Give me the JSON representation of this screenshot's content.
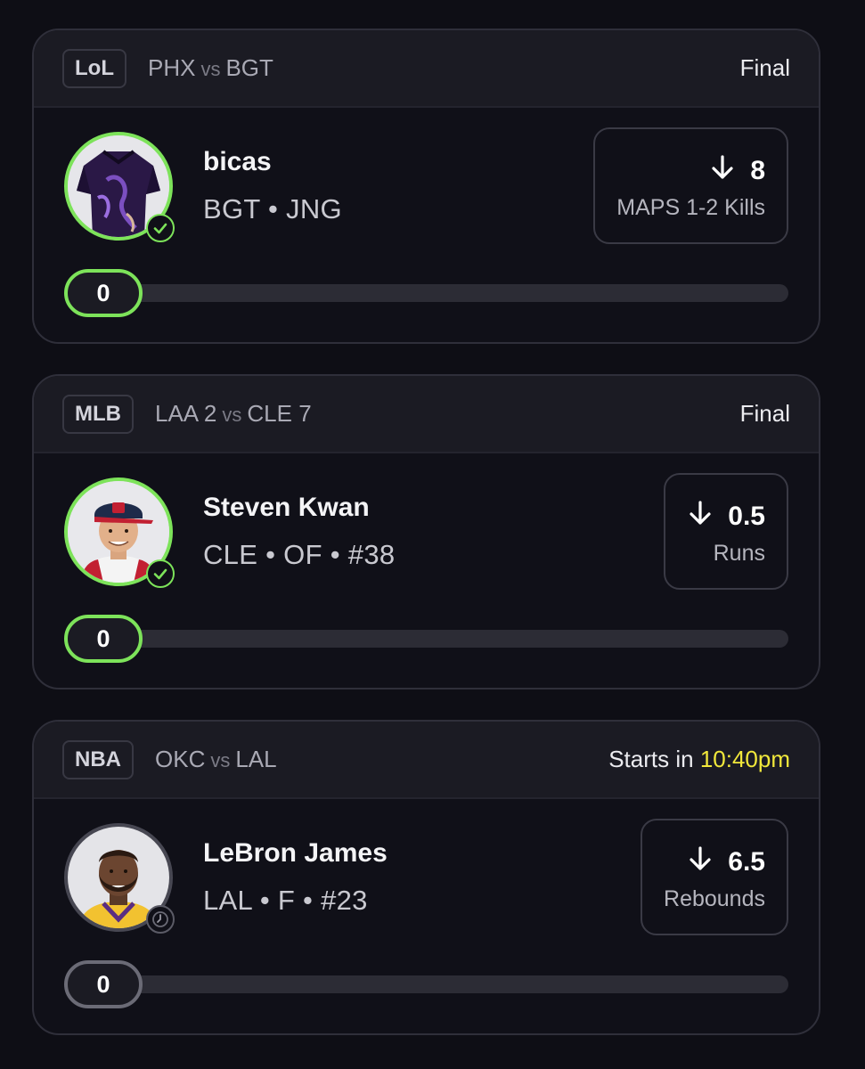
{
  "colors": {
    "accent_green": "#7de35a",
    "time_yellow": "#f1e83b",
    "background": "#0e0e15",
    "card_header": "#1b1b23"
  },
  "cards": [
    {
      "league": "LoL",
      "team1": "PHX",
      "vs": "vs",
      "team2": "BGT",
      "status": "Final",
      "player_name": "bicas",
      "player_info": "BGT • JNG",
      "direction_icon": "arrow-down-icon",
      "line_value": "8",
      "line_stat": "MAPS 1-2 Kills",
      "current_value": "0",
      "avatar": "jersey-avatar",
      "result_icon": "check-circle-icon"
    },
    {
      "league": "MLB",
      "team1": "LAA 2",
      "vs": "vs",
      "team2": "CLE 7",
      "status": "Final",
      "player_name": "Steven Kwan",
      "player_info": "CLE • OF • #38",
      "direction_icon": "arrow-down-icon",
      "line_value": "0.5",
      "line_stat": "Runs",
      "current_value": "0",
      "avatar": "player-headshot",
      "result_icon": "check-circle-icon"
    },
    {
      "league": "NBA",
      "team1": "OKC",
      "vs": "vs",
      "team2": "LAL",
      "status_prefix": "Starts in",
      "status_time": "10:40pm",
      "player_name": "LeBron James",
      "player_info": "LAL • F • #23",
      "direction_icon": "arrow-down-icon",
      "line_value": "6.5",
      "line_stat": "Rebounds",
      "current_value": "0",
      "avatar": "player-headshot",
      "result_icon": "clock-icon"
    }
  ]
}
